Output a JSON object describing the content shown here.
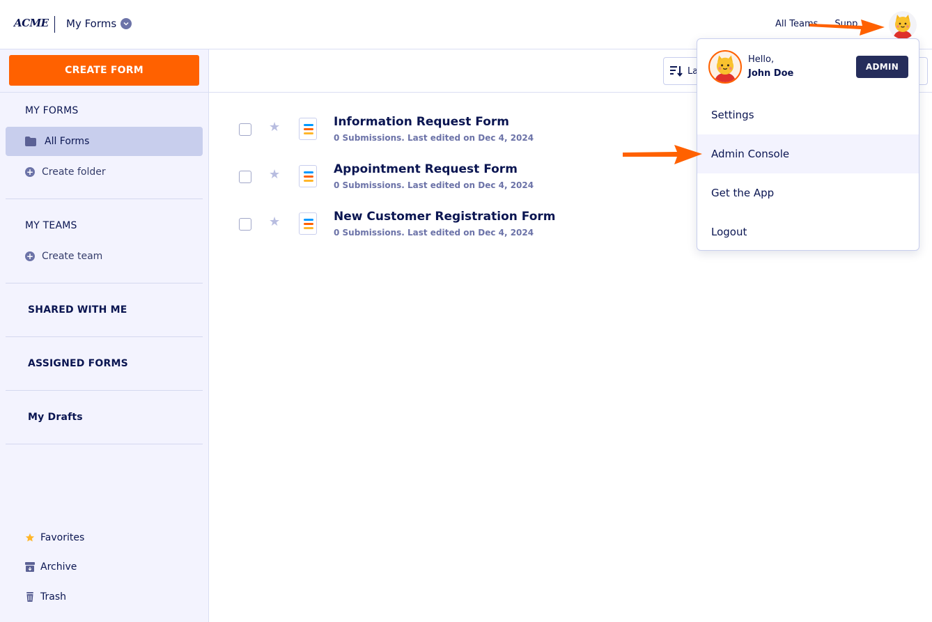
{
  "header": {
    "logo": "ACME",
    "title": "My Forms",
    "links": [
      "All Teams",
      "Supp"
    ]
  },
  "sidebar": {
    "create_button": "CREATE FORM",
    "my_forms_heading": "MY FORMS",
    "all_forms": "All Forms",
    "create_folder": "Create folder",
    "my_teams_heading": "MY TEAMS",
    "create_team": "Create team",
    "shared_with_me": "SHARED WITH ME",
    "assigned_forms": "ASSIGNED FORMS",
    "my_drafts": "My Drafts",
    "favorites": "Favorites",
    "archive": "Archive",
    "trash": "Trash"
  },
  "toolbar": {
    "sort_label": "La"
  },
  "forms": [
    {
      "title": "Information Request Form",
      "meta": "0 Submissions. Last edited on Dec 4, 2024"
    },
    {
      "title": "Appointment Request Form",
      "meta": "0 Submissions. Last edited on Dec 4, 2024"
    },
    {
      "title": "New Customer Registration Form",
      "meta": "0 Submissions. Last edited on Dec 4, 2024"
    }
  ],
  "dropdown": {
    "greeting": "Hello,",
    "user_name": "John Doe",
    "role_badge": "ADMIN",
    "items": [
      "Settings",
      "Admin Console",
      "Get the App",
      "Logout"
    ]
  },
  "colors": {
    "accent": "#ff6100",
    "navy": "#0a1551",
    "sidebar_bg": "#f3f3fe",
    "active_item": "#c8ceed",
    "badge": "#252d5b"
  }
}
